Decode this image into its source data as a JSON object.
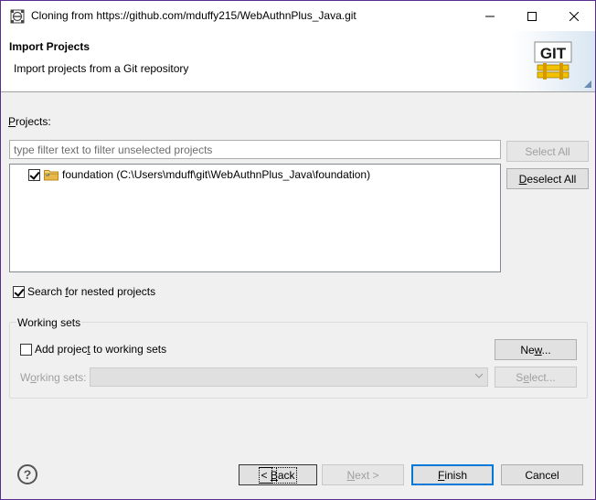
{
  "window": {
    "title": "Cloning from https://github.com/mduffy215/WebAuthnPlus_Java.git",
    "controls": {
      "minimize": "—",
      "maximize": "☐",
      "close": "✕"
    }
  },
  "banner": {
    "title": "Import Projects",
    "description": "Import projects from a Git repository",
    "logo_text": "GIT"
  },
  "projects": {
    "label_prefix": "P",
    "label_rest": "rojects:",
    "filter_placeholder": "type filter text to filter unselected projects",
    "items": [
      {
        "label": "foundation (C:\\Users\\mduff\\git\\WebAuthnPlus_Java\\foundation)",
        "checked": true
      }
    ],
    "select_all": "Select All",
    "deselect_all_prefix": "D",
    "deselect_all_rest": "eselect All"
  },
  "nested": {
    "prefix": "Search ",
    "underline": "f",
    "rest": "or nested projects",
    "checked": true
  },
  "working_sets": {
    "group_title": "Working sets",
    "add_prefix": "Add projec",
    "add_underline": "t",
    "add_rest": " to working sets",
    "add_checked": false,
    "new_prefix": "Ne",
    "new_underline": "w",
    "new_rest": "...",
    "sets_prefix": "W",
    "sets_underline": "o",
    "sets_rest": "rking sets:",
    "select_prefix": "S",
    "select_underline": "e",
    "select_rest": "lect..."
  },
  "footer": {
    "help": "?",
    "back_prefix": "< ",
    "back_underline": "B",
    "back_rest": "ack",
    "next_prefix": "",
    "next_underline": "N",
    "next_rest": "ext >",
    "finish_prefix": "",
    "finish_underline": "F",
    "finish_rest": "inish",
    "cancel": "Cancel"
  },
  "colors": {
    "accent_border": "#5b2d8e",
    "default_button": "#0078d7",
    "folder": "#e8b84a",
    "git_text": "#1a1a1a",
    "git_stripe": "#f2c200"
  }
}
